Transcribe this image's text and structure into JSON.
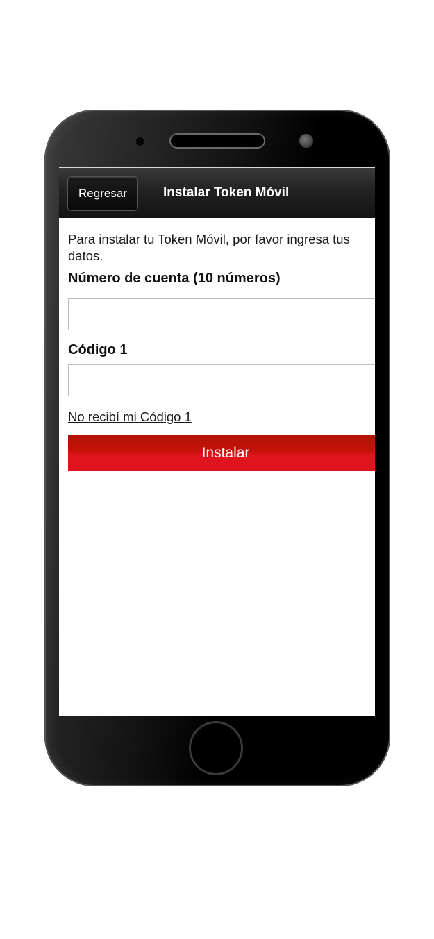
{
  "header": {
    "back_label": "Regresar",
    "title": "Instalar Token Móvil"
  },
  "form": {
    "intro_text": "Para instalar tu Token Móvil, por favor ingresa tus datos.",
    "account_label": "Número de cuenta (10 números)",
    "account_value": "",
    "code_label": "Código 1",
    "code_value": "",
    "resend_link": "No recibí mi Código 1",
    "submit_label": "Instalar"
  },
  "colors": {
    "topbar": "#1e1e1e",
    "primary_button": "#d0121a",
    "screen_background": "#ffffff",
    "device_body": "#000000"
  },
  "icons": {
    "front_camera": "camera-dot-icon",
    "earpiece": "speaker-icon",
    "proximity_sensor": "sensor-icon",
    "home": "home-button-icon"
  }
}
